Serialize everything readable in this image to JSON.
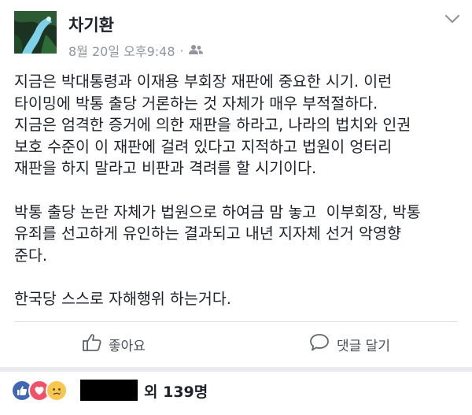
{
  "post": {
    "author": "차기환",
    "timestamp": "8월 20일 오후9:48",
    "body": [
      "지금은 박대통령과 이재용 부회장 재판에 중요한 시기. 이런",
      "타이밍에 박통 출당 거론하는 것 자체가 매우 부적절하다.",
      "지금은 엄격한 증거에 의한 재판을 하라고, 나라의 법치와 인권",
      "보호 수준이 이 재판에 걸려 있다고 지적하고 법원이 엉터리",
      "재판을 하지 말라고 비판과 격려를 할 시기이다.",
      "",
      "박통 출당 논란 자체가 법원으로 하여금 맘 놓고  이부회장, 박통",
      "유죄를 선고하게 유인하는 결과되고 내년 지자체 선거 악영향",
      "준다.",
      "",
      "한국당 스스로 자해행위 하는거다."
    ]
  },
  "actions": {
    "like_label": "좋아요",
    "comment_label": "댓글 달기"
  },
  "reactions": {
    "count_text": "외 139명",
    "types": [
      "like",
      "love",
      "sad"
    ]
  },
  "colors": {
    "text": "#1d2129",
    "meta": "#90949c",
    "like_blue": "#4267b2",
    "love_red": "#f25268",
    "sad_yellow": "#f7c74f"
  }
}
